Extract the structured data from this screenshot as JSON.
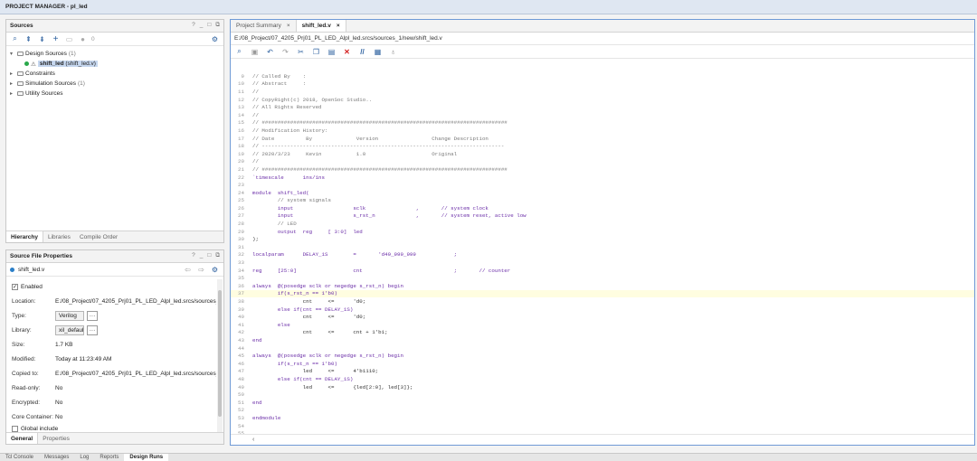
{
  "window": {
    "title": "PROJECT MANAGER - pl_led"
  },
  "sources": {
    "title": "Sources",
    "badge_count": "0",
    "tree": [
      {
        "label": "Design Sources",
        "count": "(1)",
        "expanded": true
      },
      {
        "label": "shift_led",
        "detail": "(shift_led.v)",
        "selected": true
      },
      {
        "label": "Constraints",
        "count": ""
      },
      {
        "label": "Simulation Sources",
        "count": "(1)"
      },
      {
        "label": "Utility Sources",
        "count": ""
      }
    ],
    "tabs": [
      "Hierarchy",
      "Libraries",
      "Compile Order"
    ]
  },
  "properties": {
    "title": "Source File Properties",
    "file": "shift_led.v",
    "enabled_label": "Enabled",
    "rows": {
      "location": {
        "label": "Location:",
        "value": "E:/08_Project/07_4205_Prj01_PL_LED_Alpl_led.srcs/sources_1/ne"
      },
      "type": {
        "label": "Type:",
        "value": "Verilog"
      },
      "library": {
        "label": "Library:",
        "value": "xil_defaultlib"
      },
      "size": {
        "label": "Size:",
        "value": "1.7 KB"
      },
      "modified": {
        "label": "Modified:",
        "value": "Today at 11:23:49 AM"
      },
      "copied_to": {
        "label": "Copied to:",
        "value": "E:/08_Project/07_4205_Prj01_PL_LED_Alpl_led.srcs/sources_1/ne"
      },
      "read_only": {
        "label": "Read-only:",
        "value": "No"
      },
      "encrypted": {
        "label": "Encrypted:",
        "value": "No"
      },
      "core_container": {
        "label": "Core Container:",
        "value": "No"
      },
      "global_include": {
        "label": "Global include"
      }
    },
    "tabs": [
      "General",
      "Properties"
    ]
  },
  "editor": {
    "tabs": [
      "Project Summary",
      "shift_led.v"
    ],
    "path": "E:/08_Project/07_4205_Prj01_PL_LED_Alpl_led.srcs/sources_1/new/shift_led.v",
    "lines": [
      {
        "n": "9",
        "t": "// Called By    :"
      },
      {
        "n": "10",
        "t": "// Abstract     :"
      },
      {
        "n": "11",
        "t": "//"
      },
      {
        "n": "12",
        "t": "// CopyRight(c) 2018, OpenSoc Studio.."
      },
      {
        "n": "13",
        "t": "// All Rights Reserved"
      },
      {
        "n": "14",
        "t": "//"
      },
      {
        "n": "15",
        "t": "// ##############################################################################"
      },
      {
        "n": "16",
        "t": "// Modification History:"
      },
      {
        "n": "17",
        "t": "// Date          By              Version                 Change Description"
      },
      {
        "n": "18",
        "t": "// -----------------------------------------------------------------------------"
      },
      {
        "n": "19",
        "t": "// 2020/3/23     Kevin           1.0                     Original"
      },
      {
        "n": "20",
        "t": "//"
      },
      {
        "n": "21",
        "t": "// ##############################################################################"
      },
      {
        "n": "22",
        "t": "`timescale      1ns/1ns"
      },
      {
        "n": "23",
        "t": ""
      },
      {
        "n": "24",
        "t": "module  shift_led("
      },
      {
        "n": "25",
        "t": "        // system signals"
      },
      {
        "n": "26",
        "t": "        input                   sclk                ,       // system clock"
      },
      {
        "n": "27",
        "t": "        input                   s_rst_n             ,       // system reset, active low"
      },
      {
        "n": "28",
        "t": "        // LED"
      },
      {
        "n": "29",
        "t": "        output  reg     [ 3:0]  led"
      },
      {
        "n": "30",
        "t": ");"
      },
      {
        "n": "31",
        "t": ""
      },
      {
        "n": "32",
        "t": "localparam      DELAY_1S        =       'd49_999_999            ;"
      },
      {
        "n": "33",
        "t": ""
      },
      {
        "n": "34",
        "t": "reg     [25:0]                  cnt                             ;       // counter"
      },
      {
        "n": "35",
        "t": ""
      },
      {
        "n": "36",
        "t": "always  @(posedge sclk or negedge s_rst_n) begin"
      },
      {
        "n": "37",
        "t": "        if(s_rst_n == 1'b0)"
      },
      {
        "n": "38",
        "t": "                cnt     <=      'd0;"
      },
      {
        "n": "39",
        "t": "        else if(cnt == DELAY_1S)"
      },
      {
        "n": "40",
        "t": "                cnt     <=      'd0;"
      },
      {
        "n": "41",
        "t": "        else"
      },
      {
        "n": "42",
        "t": "                cnt     <=      cnt + 1'b1;"
      },
      {
        "n": "43",
        "t": "end"
      },
      {
        "n": "44",
        "t": ""
      },
      {
        "n": "45",
        "t": "always  @(posedge sclk or negedge s_rst_n) begin"
      },
      {
        "n": "46",
        "t": "        if(s_rst_n == 1'b0)"
      },
      {
        "n": "47",
        "t": "                led     <=      4'b1110;"
      },
      {
        "n": "48",
        "t": "        else if(cnt == DELAY_1S)"
      },
      {
        "n": "49",
        "t": "                led     <=      {led[2:0], led[3]};"
      },
      {
        "n": "50",
        "t": ""
      },
      {
        "n": "51",
        "t": "end"
      },
      {
        "n": "52",
        "t": ""
      },
      {
        "n": "53",
        "t": "endmodule"
      },
      {
        "n": "54",
        "t": ""
      },
      {
        "n": "55",
        "t": ""
      }
    ]
  },
  "bottom_tabs": [
    "Tcl Console",
    "Messages",
    "Log",
    "Reports",
    "Design Runs"
  ],
  "colors": {
    "accent": "#2b5f9e",
    "selection": "#c6d7ef",
    "highlight_line": "#fffde0"
  }
}
